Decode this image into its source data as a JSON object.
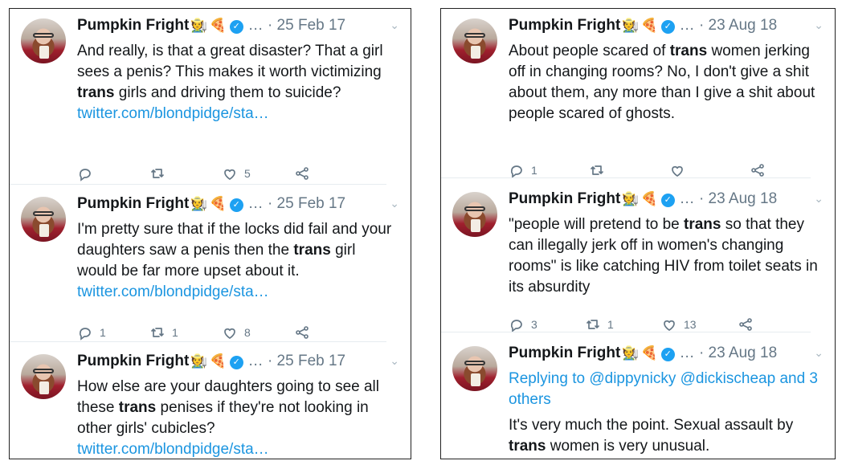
{
  "left": {
    "tweets": [
      {
        "name": "Pumpkin Fright",
        "emoji": [
          "🧑‍🌾",
          "🍕"
        ],
        "meta": "… · 25 Feb 17",
        "segments": [
          {
            "t": "And really, is that a great disaster? That a girl sees a penis? This makes it worth victimizing "
          },
          {
            "t": "trans",
            "b": true
          },
          {
            "t": " girls and driving them to suicide? "
          },
          {
            "t": "twitter.com/blondpidge/sta…",
            "link": true
          }
        ],
        "replies": "",
        "retweets": "",
        "likes": "5"
      },
      {
        "name": "Pumpkin Fright",
        "emoji": [
          "🧑‍🌾",
          "🍕"
        ],
        "meta": "… · 25 Feb 17",
        "segments": [
          {
            "t": "I'm pretty sure that if the locks did fail and your daughters saw a penis then the "
          },
          {
            "t": "trans",
            "b": true
          },
          {
            "t": " girl would be far more upset about it. "
          },
          {
            "t": "twitter.com/blondpidge/sta…",
            "link": true
          }
        ],
        "replies": "1",
        "retweets": "1",
        "likes": "8"
      },
      {
        "name": "Pumpkin Fright",
        "emoji": [
          "🧑‍🌾",
          "🍕"
        ],
        "meta": "… · 25 Feb 17",
        "segments": [
          {
            "t": "How else are your daughters going to see all these "
          },
          {
            "t": "trans",
            "b": true
          },
          {
            "t": " penises if they're not looking in other girls' cubicles? "
          },
          {
            "t": "twitter.com/blondpidge/sta…",
            "link": true
          }
        ]
      }
    ]
  },
  "right": {
    "tweets": [
      {
        "name": "Pumpkin Fright",
        "emoji": [
          "🧑‍🌾",
          "🍕"
        ],
        "meta": "… · 23 Aug 18",
        "segments": [
          {
            "t": "About people scared of "
          },
          {
            "t": "trans",
            "b": true
          },
          {
            "t": " women jerking off in changing rooms? No, I don't give a shit about them, any more than I give a shit about people scared of ghosts."
          }
        ],
        "replies": "1",
        "retweets": "",
        "likes": ""
      },
      {
        "name": "Pumpkin Fright",
        "emoji": [
          "🧑‍🌾",
          "🍕"
        ],
        "meta": "… · 23 Aug 18",
        "segments": [
          {
            "t": "\"people will pretend to be "
          },
          {
            "t": "trans",
            "b": true
          },
          {
            "t": " so that they can illegally jerk off in women's changing rooms\" is like catching HIV from toilet seats in its absurdity"
          }
        ],
        "replies": "3",
        "retweets": "1",
        "likes": "13"
      },
      {
        "name": "Pumpkin Fright",
        "emoji": [
          "🧑‍🌾",
          "🍕"
        ],
        "meta": "… · 23 Aug 18",
        "replying": "Replying to @dippynicky @dickischeap and 3 others",
        "segments": [
          {
            "t": "It's very much the point. Sexual assault by "
          },
          {
            "t": "trans",
            "b": true
          },
          {
            "t": " women is very unusual."
          }
        ]
      }
    ]
  },
  "colors": {
    "link": "#1b95e0",
    "verified": "#1da1f2",
    "muted": "#657786",
    "separator": "#e6ecf0"
  },
  "icons": {
    "reply": "reply-icon",
    "retweet": "retweet-icon",
    "like": "heart-icon",
    "share": "share-icon",
    "verified": "verified-badge-icon",
    "menu": "chevron-down-icon"
  }
}
